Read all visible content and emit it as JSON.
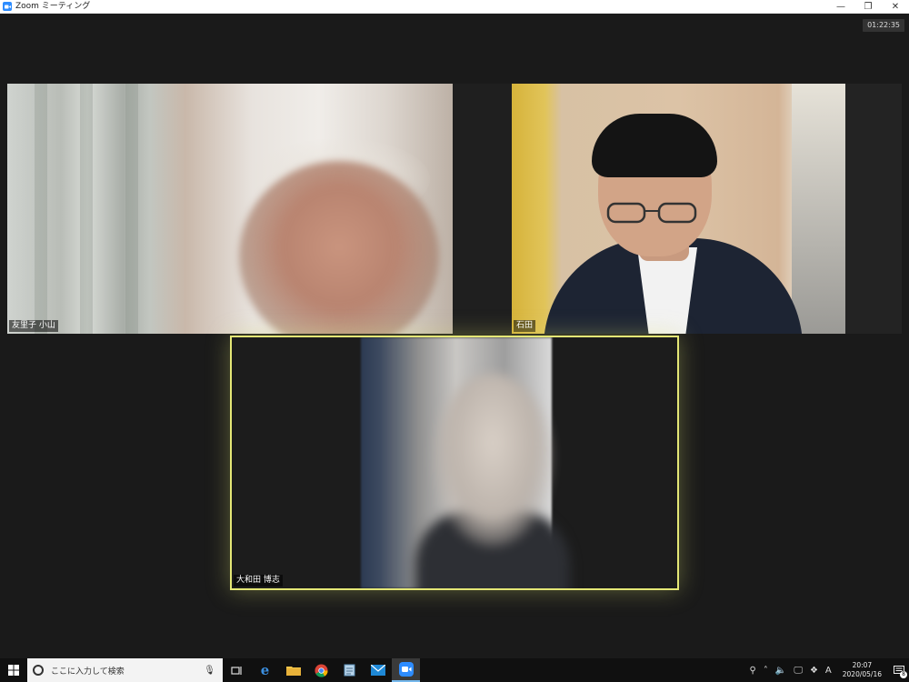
{
  "window": {
    "title": "Zoom ミーティング",
    "controls": {
      "minimize": "—",
      "restore": "❐",
      "close": "✕"
    }
  },
  "meeting": {
    "elapsed_time": "01:22:35",
    "participants": [
      {
        "name": "友里子 小山"
      },
      {
        "name": "石田"
      },
      {
        "name": "大和田 博志",
        "active_speaker": true
      }
    ]
  },
  "taskbar": {
    "search_placeholder": "ここに入力して検索",
    "apps": [
      "task-view",
      "edge",
      "file-explorer",
      "chrome",
      "notepad",
      "mail",
      "zoom"
    ],
    "tray": {
      "ime": "A",
      "time": "20:07",
      "date": "2020/05/16",
      "notification_count": "8"
    }
  },
  "colors": {
    "active_speaker_border": "#e4e776",
    "zoom_blue": "#2d8cff",
    "meeting_bg": "#1a1a1a",
    "taskbar_bg": "#101010"
  }
}
